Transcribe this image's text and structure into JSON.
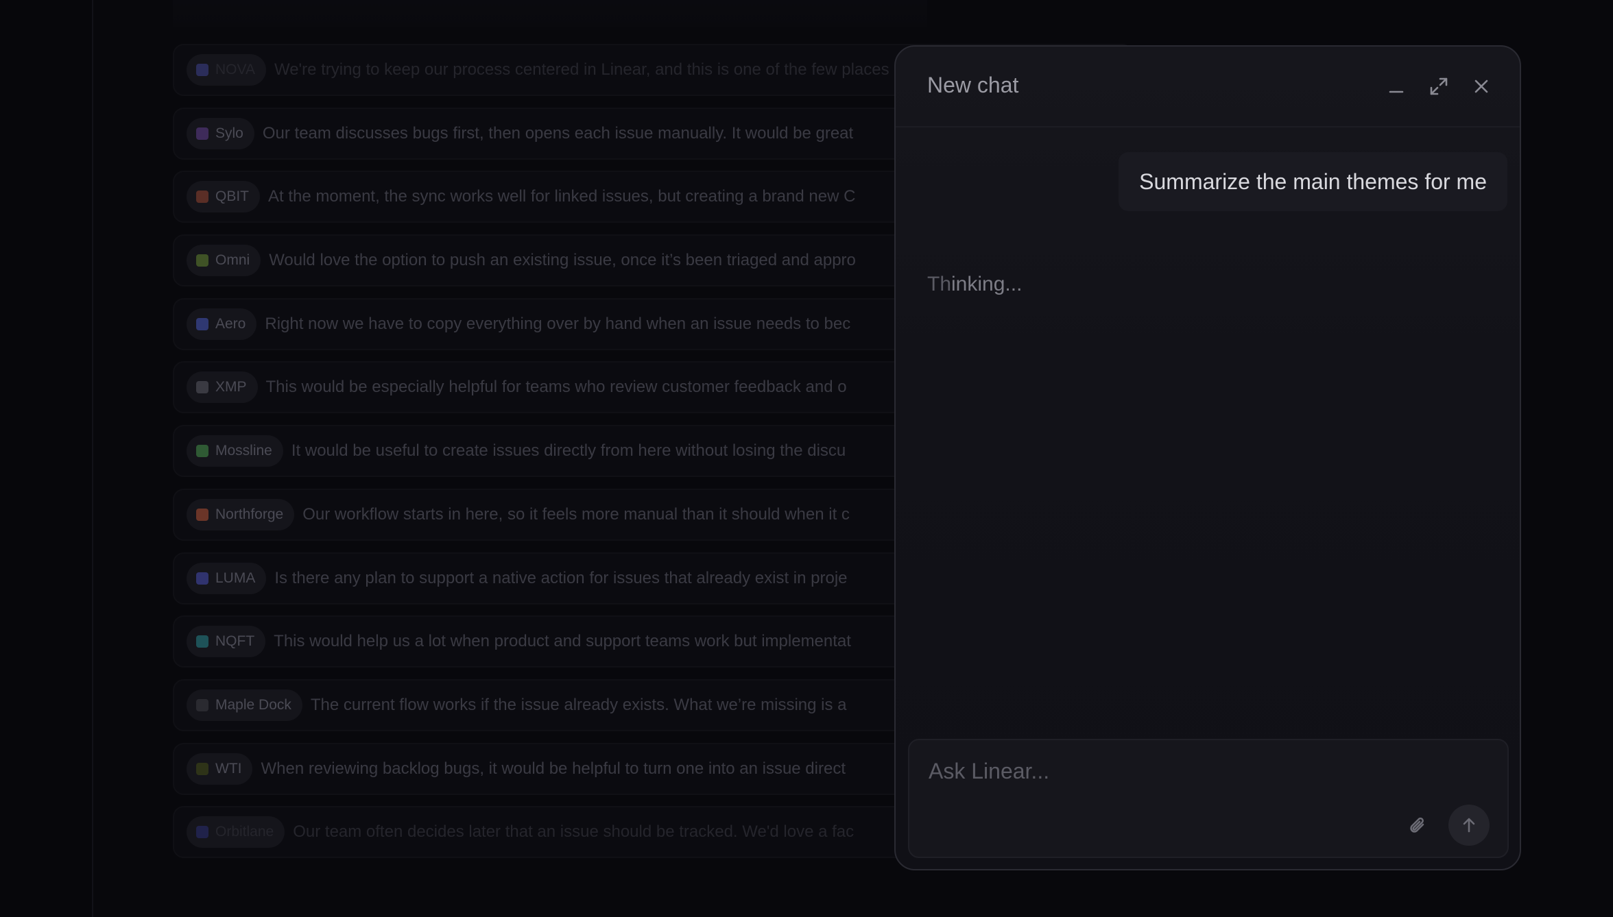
{
  "feed": {
    "items": [
      {
        "company": "NOVA",
        "color": "#2b2d5a",
        "text": "We're trying to keep our process centered in Linear, and this is one of the few places",
        "faded": true
      },
      {
        "company": "Sylo",
        "color": "#3e2b5a",
        "text": "Our team discusses bugs first, then opens each issue manually. It would be great"
      },
      {
        "company": "QBIT",
        "color": "#5a2e26",
        "text": "At the moment, the sync works well for linked issues, but creating a brand new C"
      },
      {
        "company": "Omni",
        "color": "#3f5226",
        "text": "Would love the option to push an existing issue, once it’s been triaged and appro"
      },
      {
        "company": "Aero",
        "color": "#2f3872",
        "text": "Right now we have to copy everything over by hand when an issue needs to bec"
      },
      {
        "company": "XMP",
        "color": "#3a3a42",
        "text": "This would be especially helpful for teams who review customer feedback and o"
      },
      {
        "company": "Mossline",
        "color": "#2f5a34",
        "text": "It would be useful to create issues directly from here without losing the discu"
      },
      {
        "company": "Northforge",
        "color": "#6b3528",
        "text": "Our workflow starts in here, so it feels more manual than it should when it c"
      },
      {
        "company": "LUMA",
        "color": "#30336e",
        "text": "Is there any plan to support a native action for issues that already exist in proje"
      },
      {
        "company": "NQFT",
        "color": "#1e5258",
        "text": "This would help us a lot when product and support teams work but implementat"
      },
      {
        "company": "Maple Dock",
        "color": "#2a2a30",
        "text": "The current flow works if the issue already exists. What we’re missing is a"
      },
      {
        "company": "WTI",
        "color": "#2e3318",
        "text": "When reviewing backlog bugs, it would be helpful to turn one into an issue direct"
      },
      {
        "company": "Orbitlane",
        "color": "#20224a",
        "text": "Our team often decides later that an issue should be tracked. We'd love a fac",
        "faded": true
      }
    ]
  },
  "chat": {
    "title": "New chat",
    "minimize_icon": "minimize-icon",
    "expand_icon": "expand-icon",
    "close_icon": "close-icon",
    "user_message": "Summarize the main themes for me",
    "thinking_dim": "Th",
    "thinking_rest": "inking...",
    "input_placeholder": "Ask Linear...",
    "attach_icon": "paperclip-icon",
    "send_icon": "arrow-up-icon"
  }
}
